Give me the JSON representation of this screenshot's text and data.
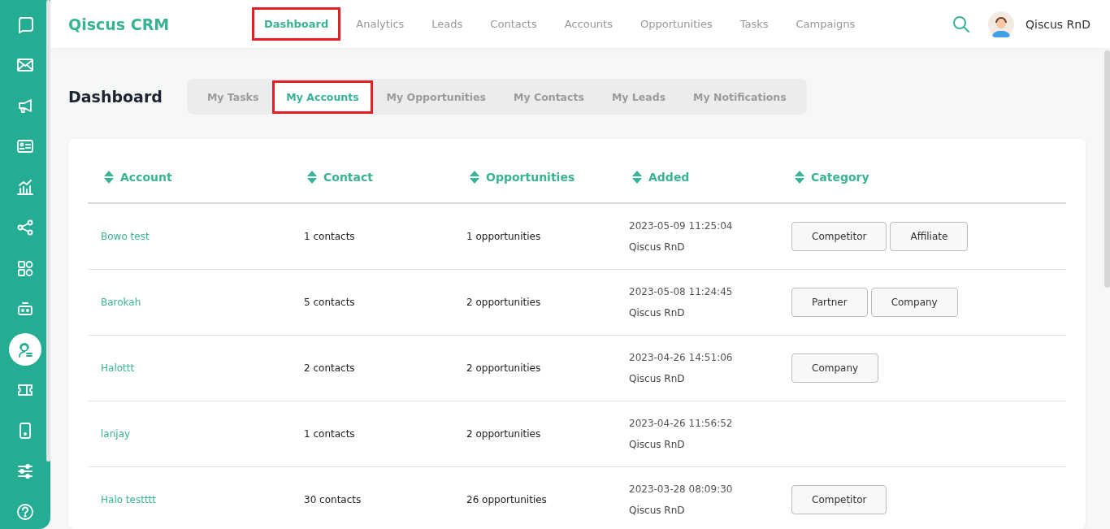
{
  "sidebar": {
    "items": [
      {
        "selected": false
      },
      {
        "selected": false
      },
      {
        "selected": false
      },
      {
        "selected": false
      },
      {
        "selected": false
      },
      {
        "selected": false
      },
      {
        "selected": false
      },
      {
        "selected": false
      },
      {
        "selected": true
      },
      {
        "selected": false
      },
      {
        "selected": false
      }
    ],
    "bottom_items": [
      {
        "selected": false
      },
      {
        "selected": false
      }
    ]
  },
  "header": {
    "brand": "Qiscus CRM",
    "nav": [
      {
        "label": "Dashboard",
        "selected": true,
        "highlighted": true
      },
      {
        "label": "Analytics",
        "selected": false,
        "highlighted": false
      },
      {
        "label": "Leads",
        "selected": false,
        "highlighted": false
      },
      {
        "label": "Contacts",
        "selected": false,
        "highlighted": false
      },
      {
        "label": "Accounts",
        "selected": false,
        "highlighted": false
      },
      {
        "label": "Opportunities",
        "selected": false,
        "highlighted": false
      },
      {
        "label": "Tasks",
        "selected": false,
        "highlighted": false
      },
      {
        "label": "Campaigns",
        "selected": false,
        "highlighted": false
      }
    ],
    "user": "Qiscus RnD"
  },
  "page_title": "Dashboard",
  "tabs": [
    {
      "label": "My Tasks",
      "selected": false,
      "highlighted": false
    },
    {
      "label": "My Accounts",
      "selected": true,
      "highlighted": true
    },
    {
      "label": "My Opportunities",
      "selected": false,
      "highlighted": false
    },
    {
      "label": "My Contacts",
      "selected": false,
      "highlighted": false
    },
    {
      "label": "My Leads",
      "selected": false,
      "highlighted": false
    },
    {
      "label": "My Notifications",
      "selected": false,
      "highlighted": false
    }
  ],
  "table": {
    "columns": [
      "Account",
      "Contact",
      "Opportunities",
      "Added",
      "Category"
    ],
    "rows": [
      {
        "account": "Bowo test",
        "contact": "1 contacts",
        "opportunities": "1 opportunities",
        "added_date": "2023-05-09 11:25:04",
        "added_by": "Qiscus RnD",
        "categories": [
          "Competitor",
          "Affiliate"
        ]
      },
      {
        "account": "Barokah",
        "contact": "5 contacts",
        "opportunities": "2 opportunities",
        "added_date": "2023-05-08 11:24:45",
        "added_by": "Qiscus RnD",
        "categories": [
          "Partner",
          "Company"
        ]
      },
      {
        "account": "Halottt",
        "contact": "2 contacts",
        "opportunities": "2 opportunities",
        "added_date": "2023-04-26 14:51:06",
        "added_by": "Qiscus RnD",
        "categories": [
          "Company"
        ]
      },
      {
        "account": "lanjay",
        "contact": "1 contacts",
        "opportunities": "2 opportunities",
        "added_date": "2023-04-26 11:56:52",
        "added_by": "Qiscus RnD",
        "categories": []
      },
      {
        "account": "Halo testttt",
        "contact": "30 contacts",
        "opportunities": "26 opportunities",
        "added_date": "2023-03-28 08:09:30",
        "added_by": "Qiscus RnD",
        "categories": [
          "Competitor"
        ]
      }
    ]
  }
}
